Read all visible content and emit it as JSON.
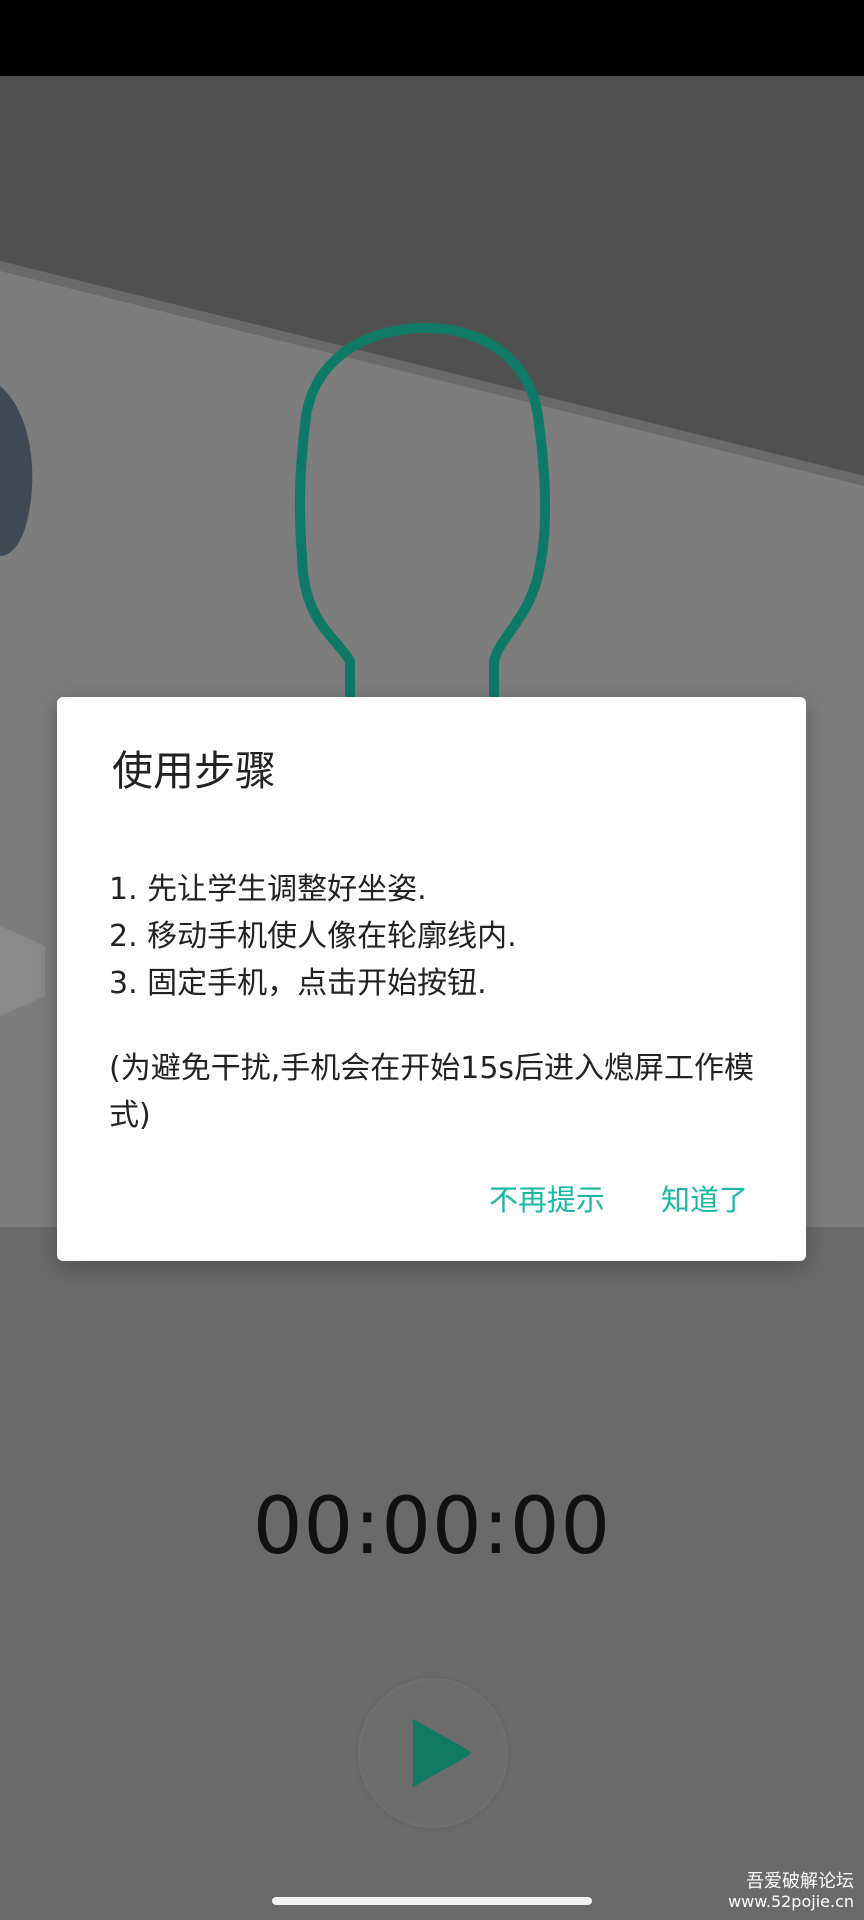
{
  "dialog": {
    "title": "使用步骤",
    "steps": [
      "1. 先让学生调整好坐姿.",
      "2. 移动手机使人像在轮廓线内.",
      "3. 固定手机，点击开始按钮."
    ],
    "note": "(为避免干扰,手机会在开始15s后进入熄屏工作模式)",
    "dont_show_again_label": "不再提示",
    "got_it_label": "知道了"
  },
  "timer": {
    "value": "00:00:00"
  },
  "watermark": {
    "name": "吾爱破解论坛",
    "url": "www.52pojie.cn"
  },
  "colors": {
    "accent": "#19b7a4",
    "outline": "#0e7a66",
    "play_icon": "#117a63",
    "overlay": "#6a6a6a"
  },
  "icons": {
    "play": "play-icon",
    "head_outline": "head-outline-icon"
  }
}
